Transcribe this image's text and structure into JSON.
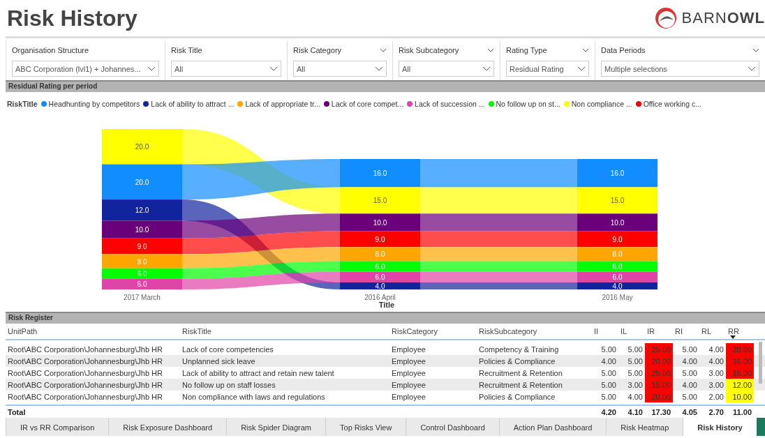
{
  "title": "Risk History",
  "logo": {
    "text": "BARN**OWL**"
  },
  "filters": [
    {
      "label": "Organisation Structure",
      "value": "ABC Corporation (lvl1) + Johannes...",
      "collapsible": false
    },
    {
      "label": "Risk Title",
      "value": "All",
      "collapsible": false
    },
    {
      "label": "Risk Category",
      "value": "All",
      "collapsible": true
    },
    {
      "label": "Risk Subcategory",
      "value": "All",
      "collapsible": true
    },
    {
      "label": "Rating Type",
      "value": "Residual Rating",
      "collapsible": true
    },
    {
      "label": "Data Periods",
      "value": "Multiple selections",
      "collapsible": true
    }
  ],
  "chart_section": {
    "title": "Residual Rating per period",
    "legend_title": "RiskTitle",
    "legend": [
      {
        "label": "Headhunting by competitors",
        "color": "#118dff"
      },
      {
        "label": "Lack of ability to attract ...",
        "color": "#12239e"
      },
      {
        "label": "Lack of appropriate tr...",
        "color": "#ffa500"
      },
      {
        "label": "Lack of core compet...",
        "color": "#6b007b"
      },
      {
        "label": "Lack of succession ...",
        "color": "#e044a7"
      },
      {
        "label": "No follow up on st...",
        "color": "#00ff00"
      },
      {
        "label": "Non compliance ...",
        "color": "#ffff00"
      },
      {
        "label": "Office working c...",
        "color": "#ff0000"
      }
    ],
    "axis_title": "Title",
    "periods": [
      {
        "label": "2017 March",
        "segments": [
          {
            "color": "#ffff00",
            "value": "20.0"
          },
          {
            "color": "#118dff",
            "value": "20.0"
          },
          {
            "color": "#12239e",
            "value": "12.0"
          },
          {
            "color": "#6b007b",
            "value": "10.0"
          },
          {
            "color": "#ff0000",
            "value": "9.0"
          },
          {
            "color": "#ffa500",
            "value": "8.0"
          },
          {
            "color": "#00ff00",
            "value": "6.0"
          },
          {
            "color": "#e044a7",
            "value": "6.0"
          }
        ]
      },
      {
        "label": "2016 April",
        "segments": [
          {
            "color": "#118dff",
            "value": "16.0"
          },
          {
            "color": "#ffff00",
            "value": "15.0"
          },
          {
            "color": "#6b007b",
            "value": "10.0"
          },
          {
            "color": "#ff0000",
            "value": "9.0"
          },
          {
            "color": "#ffa500",
            "value": "8.0"
          },
          {
            "color": "#00ff00",
            "value": "6.0"
          },
          {
            "color": "#e044a7",
            "value": "6.0"
          },
          {
            "color": "#12239e",
            "value": "4.0"
          }
        ]
      },
      {
        "label": "2016 May",
        "segments": [
          {
            "color": "#118dff",
            "value": "16.0"
          },
          {
            "color": "#ffff00",
            "value": "15.0"
          },
          {
            "color": "#6b007b",
            "value": "10.0"
          },
          {
            "color": "#ff0000",
            "value": "9.0"
          },
          {
            "color": "#ffa500",
            "value": "8.0"
          },
          {
            "color": "#00ff00",
            "value": "6.0"
          },
          {
            "color": "#e044a7",
            "value": "6.0"
          },
          {
            "color": "#12239e",
            "value": "4.0"
          }
        ]
      }
    ]
  },
  "register": {
    "title": "Risk Register",
    "columns": [
      {
        "label": "UnitPath",
        "sorted": false
      },
      {
        "label": "RiskTitle",
        "sorted": false
      },
      {
        "label": "RiskCategory",
        "sorted": false
      },
      {
        "label": "RiskSubcategory",
        "sorted": false
      },
      {
        "label": "II",
        "sorted": false
      },
      {
        "label": "IL",
        "sorted": false
      },
      {
        "label": "IR",
        "sorted": false
      },
      {
        "label": "RI",
        "sorted": false
      },
      {
        "label": "RL",
        "sorted": false
      },
      {
        "label": "RR",
        "sorted": true
      }
    ],
    "rows": [
      {
        "cells": [
          {
            "text": "Root\\ABC Corporation\\Johannesburg\\Jhb HR"
          },
          {
            "text": "Lack of core competencies"
          },
          {
            "text": "Employee"
          },
          {
            "text": "Competency & Training"
          },
          {
            "text": "5.00"
          },
          {
            "text": "5.00"
          },
          {
            "text": "25.00",
            "color": "#ff0000"
          },
          {
            "text": "5.00"
          },
          {
            "text": "4.00"
          },
          {
            "text": "20.00",
            "color": "#ff0000"
          }
        ]
      },
      {
        "cells": [
          {
            "text": "Root\\ABC Corporation\\Johannesburg\\Jhb HR"
          },
          {
            "text": "Unplanned sick leave"
          },
          {
            "text": "Employee"
          },
          {
            "text": "Policies & Compliance"
          },
          {
            "text": "4.00"
          },
          {
            "text": "5.00"
          },
          {
            "text": "20.00",
            "color": "#ff0000"
          },
          {
            "text": "4.00"
          },
          {
            "text": "4.00"
          },
          {
            "text": "16.00",
            "color": "#ff0000"
          }
        ]
      },
      {
        "cells": [
          {
            "text": "Root\\ABC Corporation\\Johannesburg\\Jhb HR"
          },
          {
            "text": "Lack of ability to attract and retain new talent"
          },
          {
            "text": "Employee"
          },
          {
            "text": "Recruitment & Retention"
          },
          {
            "text": "5.00"
          },
          {
            "text": "5.00"
          },
          {
            "text": "25.00",
            "color": "#ff0000"
          },
          {
            "text": "5.00"
          },
          {
            "text": "3.00"
          },
          {
            "text": "15.00",
            "color": "#ff0000"
          }
        ]
      },
      {
        "cells": [
          {
            "text": "Root\\ABC Corporation\\Johannesburg\\Jhb HR"
          },
          {
            "text": "No follow up on staff losses"
          },
          {
            "text": "Employee"
          },
          {
            "text": "Recruitment & Retention"
          },
          {
            "text": "5.00"
          },
          {
            "text": "3.00"
          },
          {
            "text": "15.00",
            "color": "#ff0000"
          },
          {
            "text": "4.00"
          },
          {
            "text": "3.00"
          },
          {
            "text": "12.00",
            "color": "#ffff00"
          }
        ]
      },
      {
        "cells": [
          {
            "text": "Root\\ABC Corporation\\Johannesburg\\Jhb HR"
          },
          {
            "text": "Non compliance with laws and regulations"
          },
          {
            "text": "Employee"
          },
          {
            "text": "Policies & Compliance"
          },
          {
            "text": "5.00"
          },
          {
            "text": "4.00"
          },
          {
            "text": "20.00",
            "color": "#ff0000"
          },
          {
            "text": "5.00"
          },
          {
            "text": "2.00"
          },
          {
            "text": "10.00",
            "color": "#ffff00"
          }
        ]
      }
    ],
    "total": {
      "label": "Total",
      "values": [
        "4.20",
        "4.10",
        "17.30",
        "4.05",
        "2.70",
        "11.00"
      ]
    }
  },
  "tabs": [
    {
      "label": "IR vs RR Comparison",
      "selected": false
    },
    {
      "label": "Risk Exposure Dashboard",
      "selected": false
    },
    {
      "label": "Risk Spider Diagram",
      "selected": false
    },
    {
      "label": "Top Risks View",
      "selected": false
    },
    {
      "label": "Control Dashboard",
      "selected": false
    },
    {
      "label": "Action Plan Dashboard",
      "selected": false
    },
    {
      "label": "Risk Heatmap",
      "selected": false
    },
    {
      "label": "Risk History",
      "selected": true
    }
  ]
}
